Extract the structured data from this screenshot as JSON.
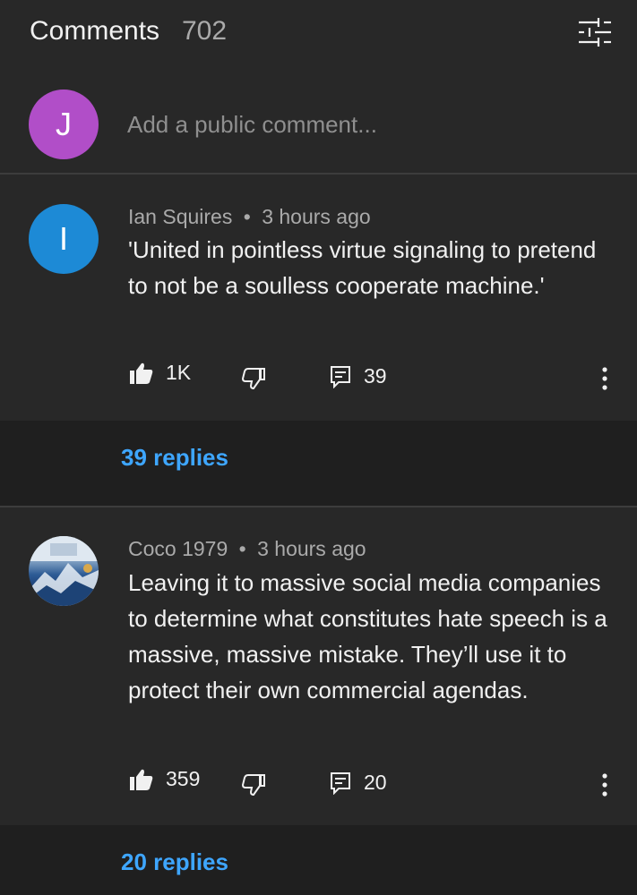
{
  "header": {
    "title": "Comments",
    "count": "702"
  },
  "add_comment": {
    "avatar_letter": "J",
    "avatar_color": "#b14ec8",
    "placeholder": "Add a public comment..."
  },
  "comments": [
    {
      "avatar_letter": "I",
      "avatar_color": "#1d8ad6",
      "author": "Ian Squires",
      "time": "3 hours ago",
      "text": "'United in pointless virtue signaling to pretend to not be a soulless cooperate machine.'",
      "likes": "1K",
      "reply_count": "39",
      "replies_label": "39 replies"
    },
    {
      "avatar_letter": "",
      "avatar_color": "#2d5b95",
      "author": "Coco 1979",
      "time": "3 hours ago",
      "text": "Leaving it to massive social media companies to determine what constitutes hate speech is a massive, massive mistake. They’ll use it to protect their own commercial agendas.",
      "likes": "359",
      "reply_count": "20",
      "replies_label": "20 replies"
    }
  ],
  "separator": "•",
  "icons": {
    "filter": "tune-sliders-icon",
    "like": "thumbs-up-icon",
    "dislike": "thumbs-down-icon",
    "reply": "comment-icon",
    "more": "vertical-dots-icon"
  },
  "colors": {
    "background": "#282828",
    "replies_bar": "#1f1f1f",
    "link": "#3ea6ff",
    "muted": "#aaaaaa"
  }
}
